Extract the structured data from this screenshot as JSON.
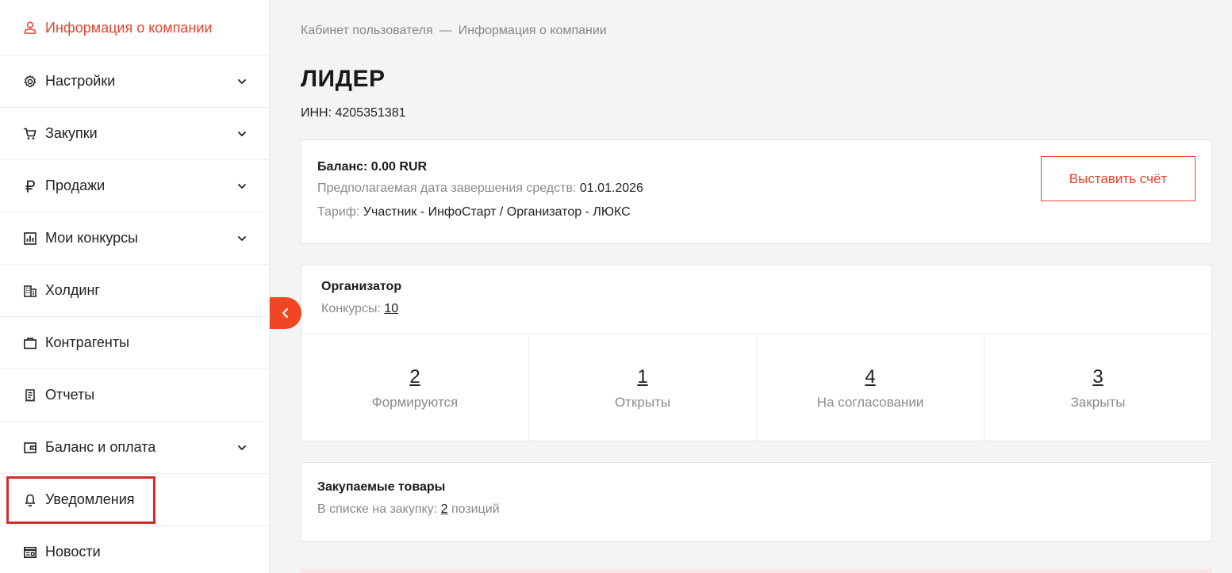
{
  "sidebar": {
    "items": [
      {
        "name": "sidebar-item-company-info",
        "icon": "user-icon",
        "label": "Информация о компании",
        "active": true,
        "chevron": false
      },
      {
        "name": "sidebar-item-settings",
        "icon": "gear-icon",
        "label": "Настройки",
        "active": false,
        "chevron": true
      },
      {
        "name": "sidebar-item-purchases",
        "icon": "cart-icon",
        "label": "Закупки",
        "active": false,
        "chevron": true
      },
      {
        "name": "sidebar-item-sales",
        "icon": "ruble-icon",
        "label": "Продажи",
        "active": false,
        "chevron": true
      },
      {
        "name": "sidebar-item-my-tenders",
        "icon": "bar-chart-icon",
        "label": "Мои конкурсы",
        "active": false,
        "chevron": true
      },
      {
        "name": "sidebar-item-holding",
        "icon": "building-icon",
        "label": "Холдинг",
        "active": false,
        "chevron": false
      },
      {
        "name": "sidebar-item-counterparties",
        "icon": "briefcase-icon",
        "label": "Контрагенты",
        "active": false,
        "chevron": false
      },
      {
        "name": "sidebar-item-reports",
        "icon": "receipt-icon",
        "label": "Отчеты",
        "active": false,
        "chevron": false
      },
      {
        "name": "sidebar-item-balance",
        "icon": "wallet-icon",
        "label": "Баланс и оплата",
        "active": false,
        "chevron": true
      },
      {
        "name": "sidebar-item-notifications",
        "icon": "bell-icon",
        "label": "Уведомления",
        "active": false,
        "chevron": false
      },
      {
        "name": "sidebar-item-news",
        "icon": "news-icon",
        "label": "Новости",
        "active": false,
        "chevron": false
      }
    ]
  },
  "breadcrumb": {
    "root": "Кабинет пользователя",
    "sep": "—",
    "current": "Информация о компании"
  },
  "company": {
    "name": "ЛИДЕР",
    "inn": "ИНН: 4205351381"
  },
  "balance": {
    "line": "Баланс: 0.00 RUR",
    "end_date_label": "Предполагаемая дата завершения средств:",
    "end_date_value": "01.01.2026",
    "tariff_label": "Тариф:",
    "tariff_value": "Участник - ИнфоСтарт / Организатор - ЛЮКС",
    "invoice_button": "Выставить счёт"
  },
  "organizer": {
    "title": "Организатор",
    "tenders_label": "Конкурсы:",
    "tenders_count": "10",
    "stats": [
      {
        "name": "stat-forming",
        "value": "2",
        "label": "Формируются"
      },
      {
        "name": "stat-open",
        "value": "1",
        "label": "Открыты"
      },
      {
        "name": "stat-approval",
        "value": "4",
        "label": "На согласовании"
      },
      {
        "name": "stat-closed",
        "value": "3",
        "label": "Закрыты"
      }
    ]
  },
  "goods": {
    "title": "Закупаемые товары",
    "list_label": "В списке на закупку:",
    "list_count": "2",
    "list_unit": "позиций"
  },
  "colors": {
    "accent": "#e8432c",
    "highlight": "#d52b2b"
  }
}
